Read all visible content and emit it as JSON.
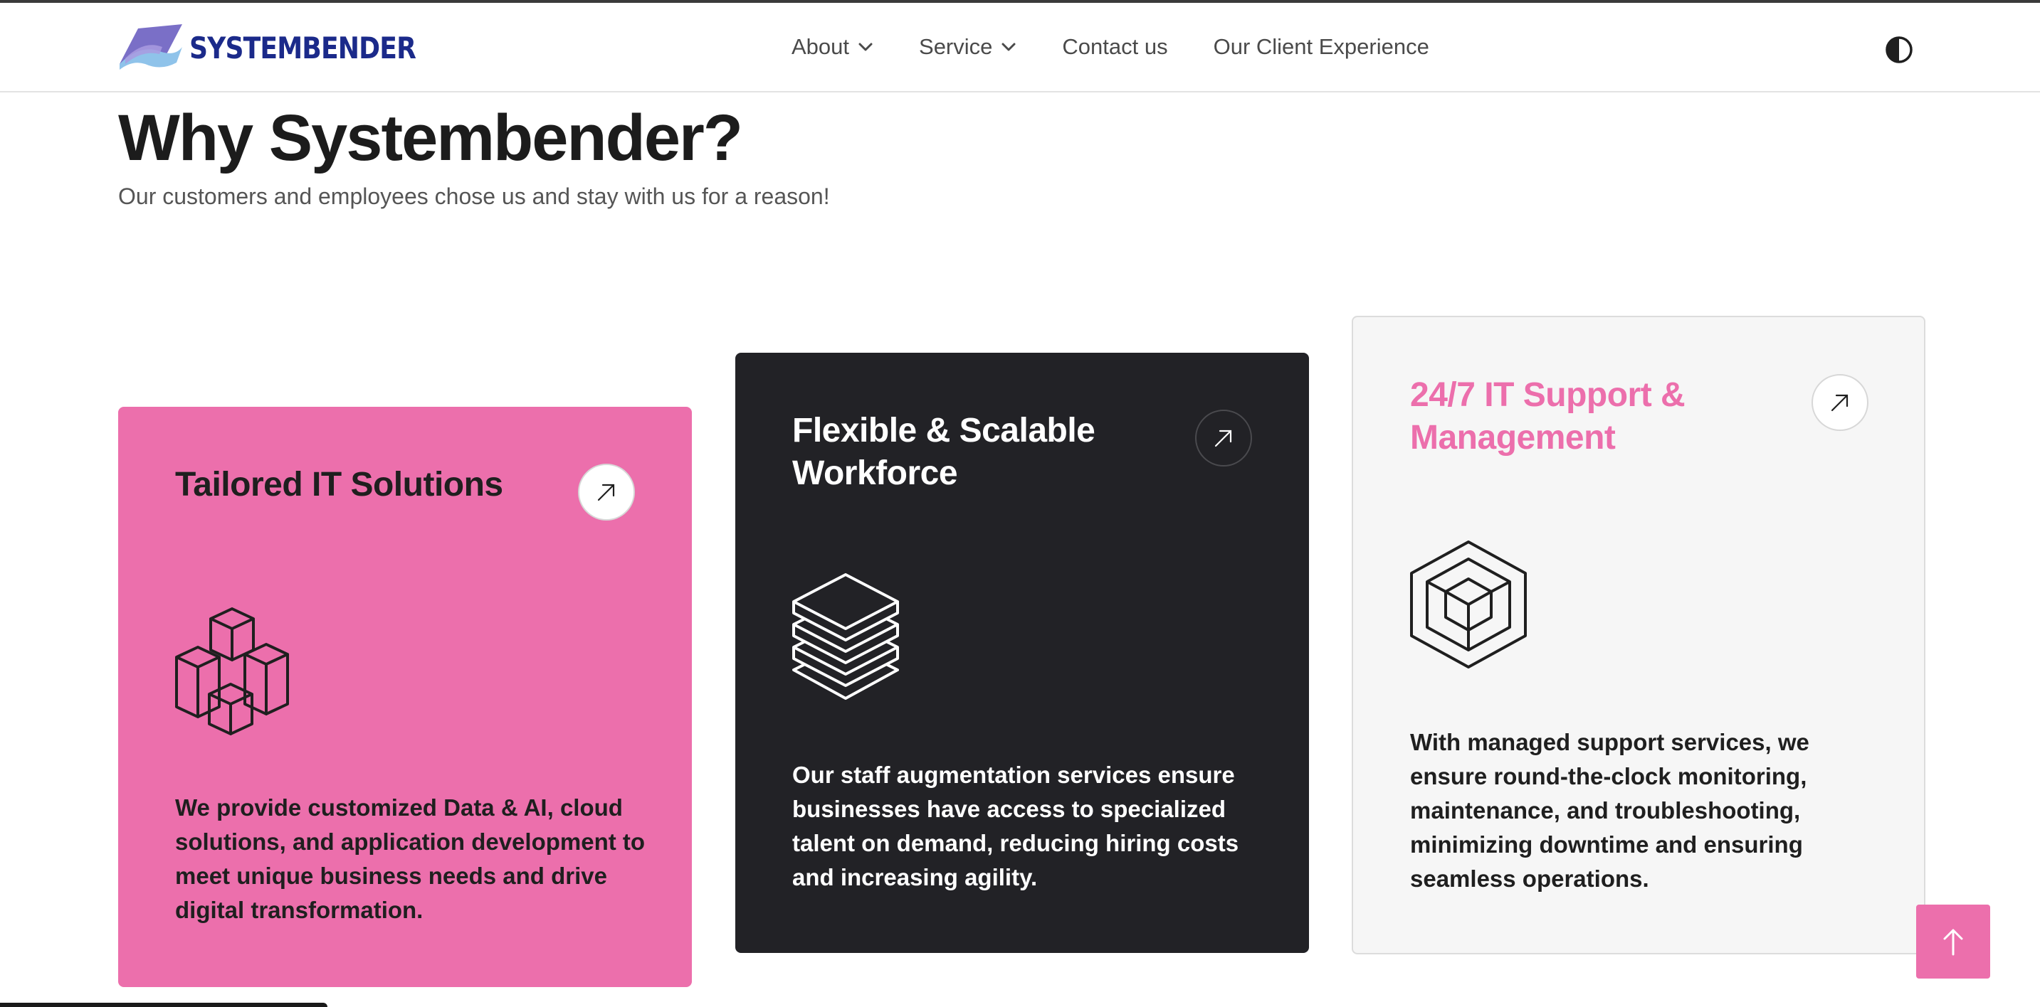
{
  "brand": {
    "name": "SYSTEMBENDER",
    "text_color": "#1b2a8a"
  },
  "nav": {
    "items": [
      {
        "label": "About",
        "has_dropdown": true
      },
      {
        "label": "Service",
        "has_dropdown": true
      },
      {
        "label": "Contact us",
        "has_dropdown": false
      },
      {
        "label": "Our Client Experience",
        "has_dropdown": false
      }
    ],
    "theme_toggle_icon": "contrast-half-circle-icon"
  },
  "hero": {
    "title": "Why Systembender?",
    "subtitle": "Our customers and employees chose us and stay with us for a reason!"
  },
  "cards": [
    {
      "title": "Tailored IT Solutions",
      "text": "We provide customized Data & AI, cloud solutions, and application development to meet unique business needs and drive digital transformation.",
      "icon": "stacked-cubes-icon",
      "background": "#ec6fac"
    },
    {
      "title": "Flexible & Scalable Workforce",
      "text": "Our staff augmentation services ensure businesses have access to specialized talent on demand, reducing hiring costs and increasing agility.",
      "icon": "layers-stack-icon",
      "background": "#222226"
    },
    {
      "title": "24/7 IT Support & Management",
      "text": "With managed support services, we ensure round-the-clock monitoring, maintenance, and troubleshooting, minimizing downtime and ensuring seamless operations.",
      "icon": "hexagon-cube-icon",
      "background": "#f6f6f6"
    }
  ],
  "colors": {
    "accent": "#ec6fac",
    "dark": "#222226",
    "light": "#f6f6f6"
  },
  "scroll_top_icon": "arrow-up-icon"
}
